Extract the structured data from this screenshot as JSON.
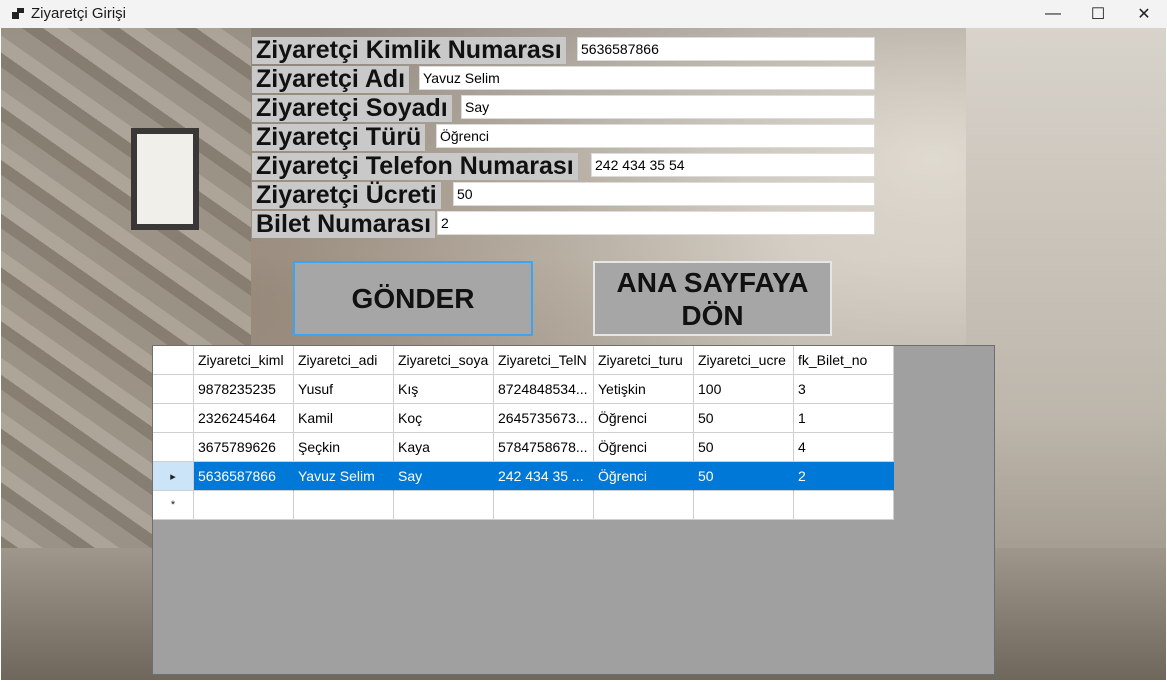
{
  "window": {
    "title": "Ziyaretçi Girişi",
    "icon": "app-window-icon",
    "controls": {
      "minimize": "—",
      "maximize": "☐",
      "close": "✕"
    }
  },
  "form": {
    "kimlik": {
      "label": "Ziyaretçi Kimlik Numarası",
      "value": "5636587866"
    },
    "adi": {
      "label": "Ziyaretçi Adı",
      "value": "Yavuz Selim"
    },
    "soyadi": {
      "label": "Ziyaretçi Soyadı",
      "value": "Say"
    },
    "turu": {
      "label": "Ziyaretçi Türü",
      "value": "Öğrenci"
    },
    "telefon": {
      "label": "Ziyaretçi Telefon Numarası",
      "value": "242 434 35 54"
    },
    "ucret": {
      "label": "Ziyaretçi Ücreti",
      "value": "50"
    },
    "bilet": {
      "label": "Bilet Numarası",
      "value": "2"
    }
  },
  "buttons": {
    "gonder": "GÖNDER",
    "ana_sayfa": "ANA SAYFAYA DÖN"
  },
  "grid": {
    "columns": [
      "Ziyaretci_kiml",
      "Ziyaretci_adi",
      "Ziyaretci_soya",
      "Ziyaretci_TelN",
      "Ziyaretci_turu",
      "Ziyaretci_ucre",
      "fk_Bilet_no"
    ],
    "rows": [
      [
        "9878235235",
        "Yusuf",
        "Kış",
        "8724848534...",
        "Yetişkin",
        "100",
        "3"
      ],
      [
        "2326245464",
        "Kamil",
        "Koç",
        "2645735673...",
        "Öğrenci",
        "50",
        "1"
      ],
      [
        "3675789626",
        "Şeçkin",
        "Kaya",
        "5784758678...",
        "Öğrenci",
        "50",
        "4"
      ],
      [
        "5636587866",
        "Yavuz Selim",
        "Say",
        "242 434 35 ...",
        "Öğrenci",
        "50",
        "2"
      ]
    ],
    "selected_row": 3,
    "current_row_marker": "▸",
    "new_row_marker": "*"
  },
  "colors": {
    "selection": "#0078d7",
    "button_bg": "#a6a6a6",
    "label_bg": "#c9c9c9",
    "grid_bg": "#a0a0a0"
  }
}
